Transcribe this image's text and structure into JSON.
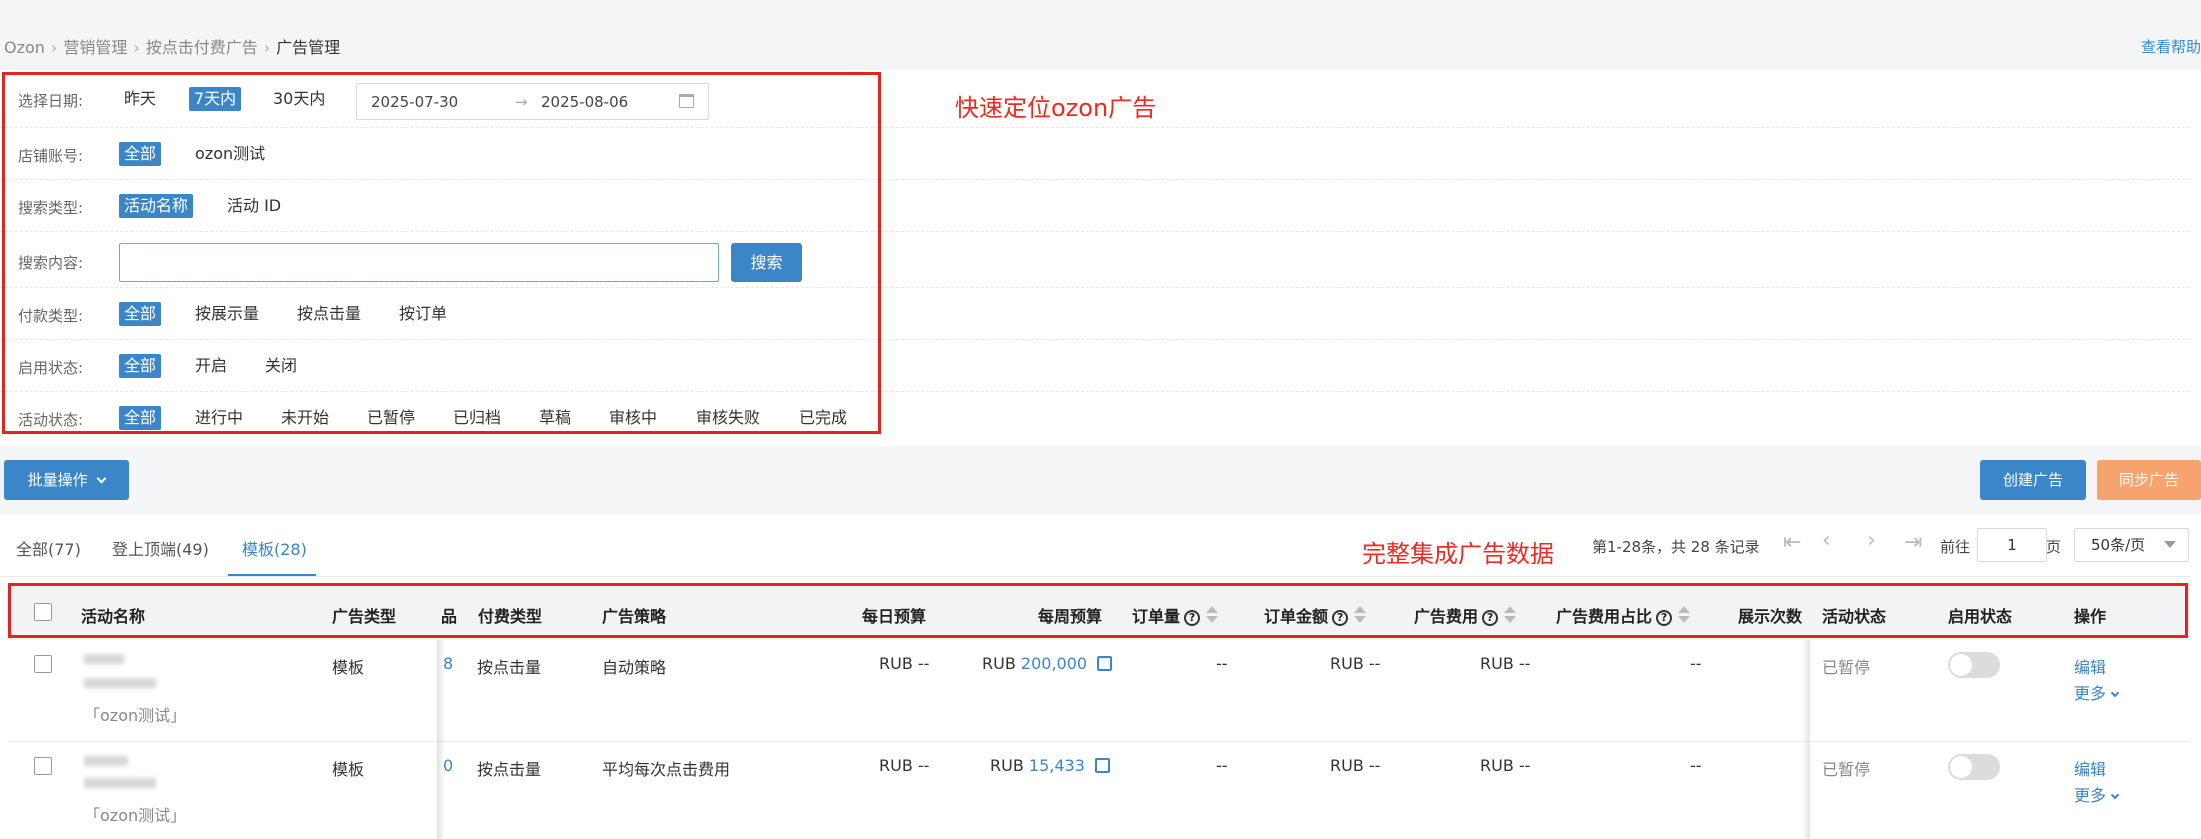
{
  "breadcrumb": {
    "items": [
      "Ozon",
      "营销管理",
      "按点击付费广告"
    ],
    "current": "广告管理"
  },
  "help_link": "查看帮助",
  "filters": {
    "date": {
      "label": "选择日期:",
      "options": [
        "昨天",
        "7天内",
        "30天内"
      ],
      "selected": "7天内",
      "start": "2025-07-30",
      "end": "2025-08-06",
      "arrow": "→"
    },
    "store": {
      "label": "店铺账号:",
      "options": [
        "全部",
        "ozon测试"
      ],
      "selected": "全部"
    },
    "search_type": {
      "label": "搜索类型:",
      "options": [
        "活动名称",
        "活动 ID"
      ],
      "selected": "活动名称"
    },
    "search_content": {
      "label": "搜索内容:",
      "value": "",
      "button": "搜索"
    },
    "pay_type": {
      "label": "付款类型:",
      "options": [
        "全部",
        "按展示量",
        "按点击量",
        "按订单"
      ],
      "selected": "全部"
    },
    "enable_status": {
      "label": "启用状态:",
      "options": [
        "全部",
        "开启",
        "关闭"
      ],
      "selected": "全部"
    },
    "activity_status": {
      "label": "活动状态:",
      "options": [
        "全部",
        "进行中",
        "未开始",
        "已暂停",
        "已归档",
        "草稿",
        "审核中",
        "审核失败",
        "已完成"
      ],
      "selected": "全部"
    }
  },
  "annotations": {
    "filter_note": "快速定位ozon广告",
    "table_note": "完整集成广告数据"
  },
  "actions": {
    "batch": "批量操作",
    "create": "创建广告",
    "sync": "同步广告"
  },
  "tabs": [
    {
      "label": "全部(77)",
      "active": false
    },
    {
      "label": "登上顶端(49)",
      "active": false
    },
    {
      "label": "模板(28)",
      "active": true
    }
  ],
  "pagination": {
    "summary": "第1-28条，共 28 条记录",
    "goto_label": "前往",
    "page": "1",
    "page_unit": "页",
    "page_size": "50条/页"
  },
  "table": {
    "headers": {
      "name": "活动名称",
      "ad_type": "广告类型",
      "product_partial": "品",
      "pay_type": "付费类型",
      "strategy": "广告策略",
      "daily_budget": "每日预算",
      "weekly_budget": "每周预算",
      "orders": "订单量",
      "order_amount": "订单金额",
      "ad_cost": "广告费用",
      "ad_cost_ratio": "广告费用占比",
      "impressions": "展示次数",
      "activity_status": "活动状态",
      "enable_status": "启用状态",
      "operation": "操作"
    },
    "rows": [
      {
        "store": "「ozon测试」",
        "ad_type": "模板",
        "product_partial": "8",
        "pay_type": "按点击量",
        "strategy": "自动策略",
        "daily_budget": "RUB --",
        "weekly_currency": "RUB",
        "weekly_value": "200,000",
        "orders": "--",
        "order_amount": "RUB --",
        "ad_cost": "RUB --",
        "ad_cost_ratio": "--",
        "activity_status": "已暂停",
        "enabled": false,
        "edit": "编辑",
        "more": "更多"
      },
      {
        "store": "「ozon测试」",
        "ad_type": "模板",
        "product_partial": "0",
        "pay_type": "按点击量",
        "strategy": "平均每次点击费用",
        "daily_budget": "RUB --",
        "weekly_currency": "RUB",
        "weekly_value": "15,433",
        "orders": "--",
        "order_amount": "RUB --",
        "ad_cost": "RUB --",
        "ad_cost_ratio": "--",
        "activity_status": "已暂停",
        "enabled": false,
        "edit": "编辑",
        "more": "更多"
      }
    ]
  },
  "colors": {
    "primary": "#3a86c8",
    "annotation_red": "#e5231f",
    "sync_button": "#f7a36d"
  }
}
